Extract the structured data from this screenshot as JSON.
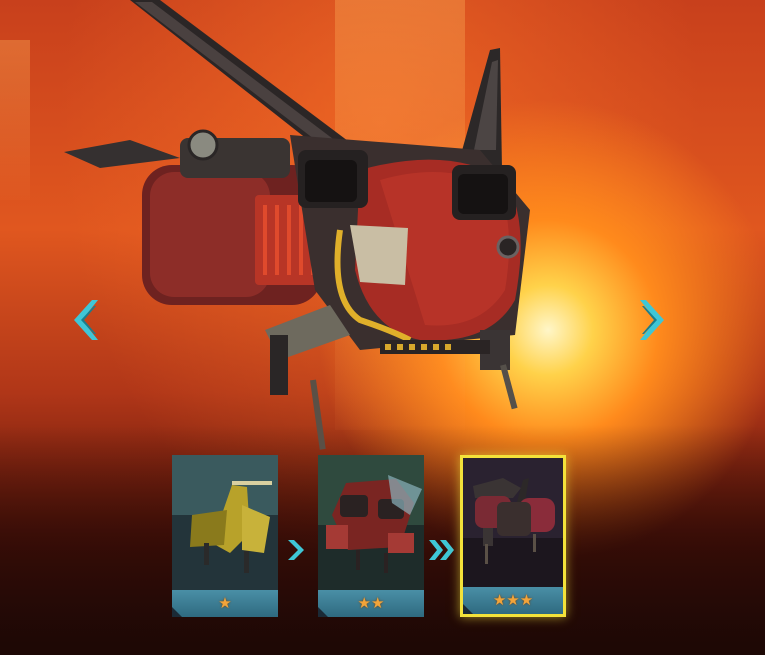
{
  "scene": {
    "background": "hangar-sunset",
    "accent": "#3fc6d6",
    "selected_border": "#f3e23a",
    "star_color": "#f2a43a"
  },
  "ship": {
    "name": "",
    "color": "#9a2a24"
  },
  "navigation": {
    "prev_icon": "chevron-left-icon",
    "next_icon": "chevron-right-icon"
  },
  "evolution": {
    "stages": [
      {
        "stars": "★",
        "rank": 1,
        "color": "#b8a22a",
        "selected": false
      },
      {
        "stars": "★★",
        "rank": 2,
        "color": "#a53a35",
        "selected": false
      },
      {
        "stars": "★★★",
        "rank": 3,
        "color": "#8a2c3a",
        "selected": true
      }
    ],
    "arrow_icons": [
      "chevron-right-icon",
      "double-chevron-right-icon"
    ]
  }
}
